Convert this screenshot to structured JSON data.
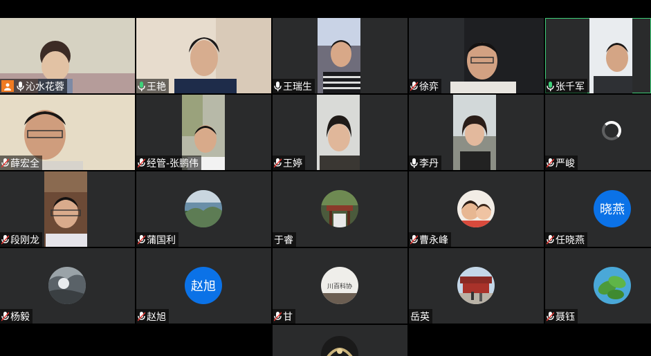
{
  "participants": [
    {
      "name": "沁水花蓉",
      "mic": "on",
      "host": true,
      "media": "video"
    },
    {
      "name": "王艳",
      "mic": "active",
      "host": false,
      "media": "video"
    },
    {
      "name": "王瑞生",
      "mic": "on",
      "host": false,
      "media": "video"
    },
    {
      "name": "徐弈",
      "mic": "muted",
      "host": false,
      "media": "video"
    },
    {
      "name": "张千军",
      "mic": "active",
      "host": false,
      "media": "video",
      "active_speaker": true
    },
    {
      "name": "薛宏全",
      "mic": "muted",
      "host": false,
      "media": "video"
    },
    {
      "name": "经管-张鹏伟",
      "mic": "muted",
      "host": false,
      "media": "video"
    },
    {
      "name": "王婷",
      "mic": "muted",
      "host": false,
      "media": "video"
    },
    {
      "name": "李丹",
      "mic": "on",
      "host": false,
      "media": "video"
    },
    {
      "name": "严峻",
      "mic": "muted",
      "host": false,
      "media": "loading"
    },
    {
      "name": "段刚龙",
      "mic": "muted",
      "host": false,
      "media": "video"
    },
    {
      "name": "蒲国利",
      "mic": "muted",
      "host": false,
      "media": "avatar-image"
    },
    {
      "name": "于睿",
      "mic": "none",
      "host": false,
      "media": "avatar-image"
    },
    {
      "name": "曹永峰",
      "mic": "muted",
      "host": false,
      "media": "avatar-image"
    },
    {
      "name": "任晓燕",
      "mic": "muted",
      "host": false,
      "media": "avatar-text",
      "avatar_text": "晓燕"
    },
    {
      "name": "杨毅",
      "mic": "muted",
      "host": false,
      "media": "avatar-image"
    },
    {
      "name": "赵旭",
      "mic": "muted",
      "host": false,
      "media": "avatar-text",
      "avatar_text": "赵旭"
    },
    {
      "name": "甘",
      "mic": "muted",
      "host": false,
      "media": "avatar-image",
      "avatar_caption": "川百科协"
    },
    {
      "name": "岳英",
      "mic": "none",
      "host": false,
      "media": "avatar-image"
    },
    {
      "name": "聂钰",
      "mic": "muted",
      "host": false,
      "media": "avatar-image"
    },
    {
      "name": "",
      "mic": "none",
      "host": false,
      "media": "avatar-image"
    }
  ],
  "colors": {
    "tile_bg": "#2a2b2c",
    "active_outline": "#3fd07a",
    "avatar_blue": "#0b72e7",
    "host_badge": "#f07b22",
    "muted_red": "#e53935",
    "mic_active": "#3fd07a"
  }
}
